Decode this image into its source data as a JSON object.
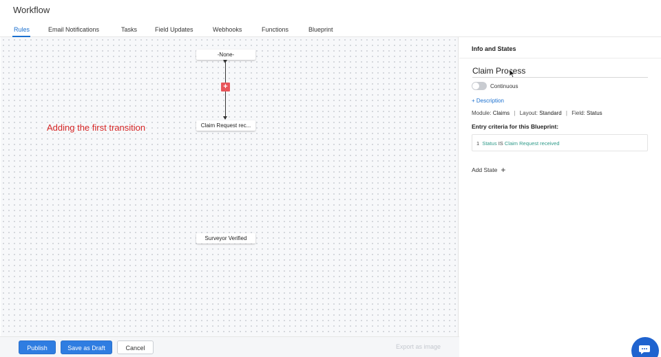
{
  "app": {
    "title": "Workflow"
  },
  "tabs": [
    {
      "label": "Rules",
      "active": true
    },
    {
      "label": "Email Notifications",
      "active": false
    },
    {
      "label": "Tasks",
      "active": false
    },
    {
      "label": "Field Updates",
      "active": false
    },
    {
      "label": "Webhooks",
      "active": false
    },
    {
      "label": "Functions",
      "active": false
    },
    {
      "label": "Blueprint",
      "active": false
    }
  ],
  "canvas": {
    "nodes": [
      {
        "label": "-None-"
      },
      {
        "label": "Claim Request rec..."
      },
      {
        "label": "Surveyor Verified"
      }
    ],
    "add_transition_glyph": "+",
    "annotation": "Adding the first transition",
    "annotation_color": "#d62626"
  },
  "footer": {
    "publish_label": "Publish",
    "save_draft_label": "Save as Draft",
    "cancel_label": "Cancel",
    "export_label": "Export as image"
  },
  "panel": {
    "title": "Info and States",
    "blueprint_name": "Claim Process",
    "toggle_label": "Continuous",
    "toggle_on": false,
    "add_description": "+ Description",
    "meta": {
      "module_label": "Module:",
      "module_value": "Claims",
      "layout_label": "Layout:",
      "layout_value": "Standard",
      "field_label": "Field:",
      "field_value": "Status",
      "separator": "|"
    },
    "criteria_title": "Entry criteria for this Blueprint:",
    "criteria": {
      "index": "1",
      "field": "Status",
      "operator": "IS",
      "value": "Claim Request received"
    },
    "add_state_label": "Add State",
    "add_state_glyph": "+"
  },
  "colors": {
    "accent": "#1a6fcf",
    "primary_button": "#2f7de1",
    "add_transition": "#e8555a",
    "criteria_value": "#2e9a89",
    "chat": "#1f63cf"
  },
  "icons": {
    "cursor": "pointer-cursor-icon",
    "chat": "chat-bubble-icon"
  }
}
